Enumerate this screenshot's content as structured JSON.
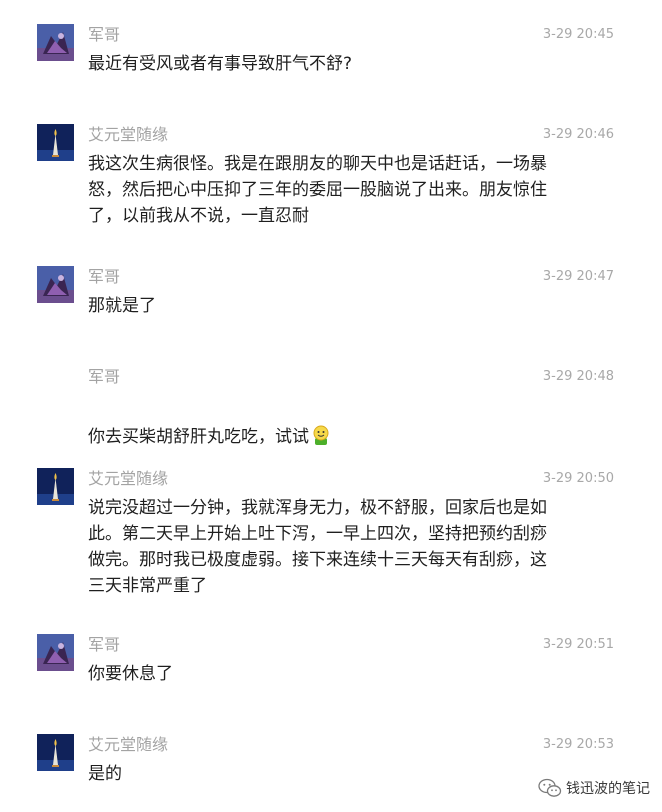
{
  "messages": [
    {
      "sender": "军哥",
      "time": "3-29 20:45",
      "text": "最近有受风或者有事导致肝气不舒?",
      "avatar": "junge-avatar"
    },
    {
      "sender": "艾元堂随缘",
      "time": "3-29 20:46",
      "text": "我这次生病很怪。我是在跟朋友的聊天中也是话赶话，一场暴\n怒，然后把心中压抑了三年的委屈一股脑说了出来。朋友惊住\n了，以前我从不说，一直忍耐",
      "avatar": "aiyuantang-avatar"
    },
    {
      "sender": "军哥",
      "time": "3-29 20:47",
      "text": "那就是了",
      "avatar": "junge-avatar"
    },
    {
      "sender": "军哥",
      "time": "3-29 20:48",
      "text": "你去买柴胡舒肝丸吃吃，试试",
      "emoji": "smiley-icon"
    },
    {
      "sender": "艾元堂随缘",
      "time": "3-29 20:50",
      "text": "说完没超过一分钟，我就浑身无力，极不舒服，回家后也是如\n此。第二天早上开始上吐下泻，一早上四次，坚持把预约刮痧\n做完。那时我已极度虚弱。接下来连续十三天每天有刮痧，这\n三天非常严重了",
      "avatar": "aiyuantang-avatar"
    },
    {
      "sender": "军哥",
      "time": "3-29 20:51",
      "text": "你要休息了",
      "avatar": "junge-avatar"
    },
    {
      "sender": "艾元堂随缘",
      "time": "3-29 20:53",
      "text": "是的",
      "avatar": "aiyuantang-avatar"
    }
  ],
  "watermark": {
    "text": "钱迅波的笔记",
    "icon": "wechat-icon"
  },
  "colors": {
    "name": "#a3a3a3",
    "time": "#a8a8a8",
    "text": "#1f1f1f"
  }
}
